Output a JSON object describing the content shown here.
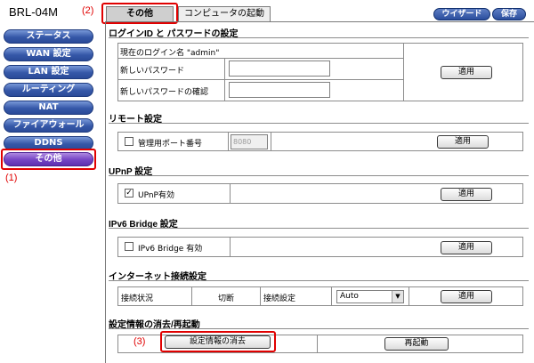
{
  "model": "BRL-04M",
  "annotations": {
    "one": "(1)",
    "two": "(2)",
    "three": "(3)"
  },
  "tabs": [
    {
      "label": "その他"
    },
    {
      "label": "コンピュータの起動"
    }
  ],
  "top_buttons": {
    "wizard": "ウイザード",
    "save": "保存"
  },
  "sidebar": {
    "items": [
      {
        "label": "ステータス"
      },
      {
        "label": "WAN 設定"
      },
      {
        "label": "LAN 設定"
      },
      {
        "label": "ルーティング"
      },
      {
        "label": "NAT"
      },
      {
        "label": "ファイアウォール"
      },
      {
        "label": "DDNS"
      },
      {
        "label": "その他"
      }
    ]
  },
  "login": {
    "title": "ログインID と パスワードの設定",
    "current": "現在のログイン名 \"admin\"",
    "new_password": "新しいパスワード",
    "confirm_password": "新しいパスワードの確認",
    "apply": "適用"
  },
  "remote": {
    "title": "リモート設定",
    "port_label": "管理用ポート番号",
    "port_value": "8080",
    "apply": "適用"
  },
  "upnp": {
    "title": "UPnP 設定",
    "enable_label": "UPnP有効",
    "enable_mark": "✓",
    "apply": "適用"
  },
  "ipv6": {
    "title": "IPv6 Bridge 設定",
    "enable_label": "IPv6 Bridge 有効",
    "apply": "適用"
  },
  "internet": {
    "title": "インターネット接続設定",
    "status_label": "接続状況",
    "status_value": "切断",
    "setting_label": "接続設定",
    "setting_value": "Auto",
    "apply": "適用"
  },
  "reset": {
    "title": "設定情報の消去/再起動",
    "clear": "設定情報の消去",
    "reboot": "再起動"
  }
}
